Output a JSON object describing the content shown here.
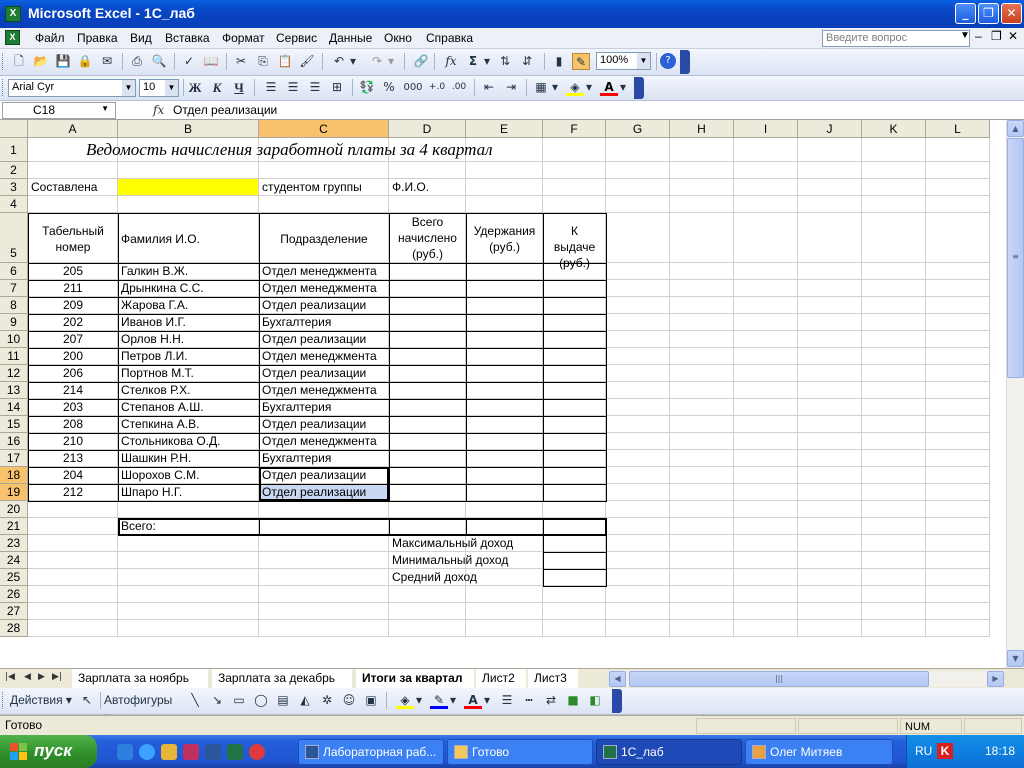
{
  "window": {
    "title": "Microsoft Excel - 1С_лаб"
  },
  "menu": {
    "items": [
      "Файл",
      "Правка",
      "Вид",
      "Вставка",
      "Формат",
      "Сервис",
      "Данные",
      "Окно",
      "Справка"
    ],
    "help_placeholder": "Введите вопрос"
  },
  "toolbar": {
    "zoom": "100%"
  },
  "format_toolbar": {
    "font": "Arial Cyr",
    "size": "10",
    "bold": "Ж",
    "italic": "К",
    "underline": "Ч",
    "currency": "%",
    "thousands": "000"
  },
  "formula_bar": {
    "name_box": "C18",
    "fx": "fx",
    "content": "Отдел реализации"
  },
  "columns": [
    "A",
    "B",
    "C",
    "D",
    "E",
    "F",
    "G",
    "H",
    "I",
    "J",
    "K",
    "L"
  ],
  "rows": [
    "1",
    "2",
    "3",
    "4",
    "5",
    "6",
    "7",
    "8",
    "9",
    "10",
    "11",
    "12",
    "13",
    "14",
    "15",
    "16",
    "17",
    "18",
    "19",
    "20",
    "21",
    "23",
    "24",
    "25",
    "26",
    "27",
    "28"
  ],
  "sheet": {
    "title": "Ведомость начисления заработной платы за 4 квартал",
    "compiled_label": "Составлена",
    "group_label": "студентом группы",
    "fio_label": "Ф.И.О.",
    "headers": [
      "Табельный номер",
      "Фамилия И.О.",
      "Подразделение",
      "Всего начислено (руб.)",
      "Удержания (руб.)",
      "К выдаче (руб.)"
    ],
    "employees": [
      {
        "id": "205",
        "name": "Галкин В.Ж.",
        "dept": "Отдел менеджмента"
      },
      {
        "id": "211",
        "name": "Дрынкина С.С.",
        "dept": "Отдел менеджмента"
      },
      {
        "id": "209",
        "name": "Жарова Г.А.",
        "dept": "Отдел реализации"
      },
      {
        "id": "202",
        "name": "Иванов И.Г.",
        "dept": "Бухгалтерия"
      },
      {
        "id": "207",
        "name": "Орлов Н.Н.",
        "dept": "Отдел реализации"
      },
      {
        "id": "200",
        "name": "Петров Л.И.",
        "dept": "Отдел менеджмента"
      },
      {
        "id": "206",
        "name": "Портнов М.Т.",
        "dept": "Отдел реализации"
      },
      {
        "id": "214",
        "name": "Стелков Р.Х.",
        "dept": "Отдел менеджмента"
      },
      {
        "id": "203",
        "name": "Степанов А.Ш.",
        "dept": "Бухгалтерия"
      },
      {
        "id": "208",
        "name": "Степкина А.В.",
        "dept": "Отдел реализации"
      },
      {
        "id": "210",
        "name": "Стольникова О.Д.",
        "dept": "Отдел менеджмента"
      },
      {
        "id": "213",
        "name": "Шашкин Р.Н.",
        "dept": "Бухгалтерия"
      },
      {
        "id": "204",
        "name": "Шорохов С.М.",
        "dept": "Отдел реализации"
      },
      {
        "id": "212",
        "name": "Шпаро Н.Г.",
        "dept": "Отдел реализации"
      }
    ],
    "total_label": "Всего:",
    "stats": [
      "Максимальный доход",
      "Минимальный доход",
      "Средний доход"
    ],
    "highlight_color": "#ffff00",
    "selection_color": "#c9d7f1"
  },
  "tabs": [
    "Зарплата за ноябрь",
    "Зарплата за декабрь",
    "Итоги за квартал",
    "Лист2",
    "Лист3"
  ],
  "drawing_toolbar": {
    "actions": "Действия",
    "autoshapes": "Автофигуры"
  },
  "status": {
    "ready": "Готово",
    "num": "NUM"
  },
  "taskbar": {
    "start": "пуск",
    "tasks": [
      "Лабораторная раб...",
      "Готово",
      "1С_лаб",
      "Олег Митяев"
    ],
    "lang": "RU",
    "clock": "18:18"
  }
}
